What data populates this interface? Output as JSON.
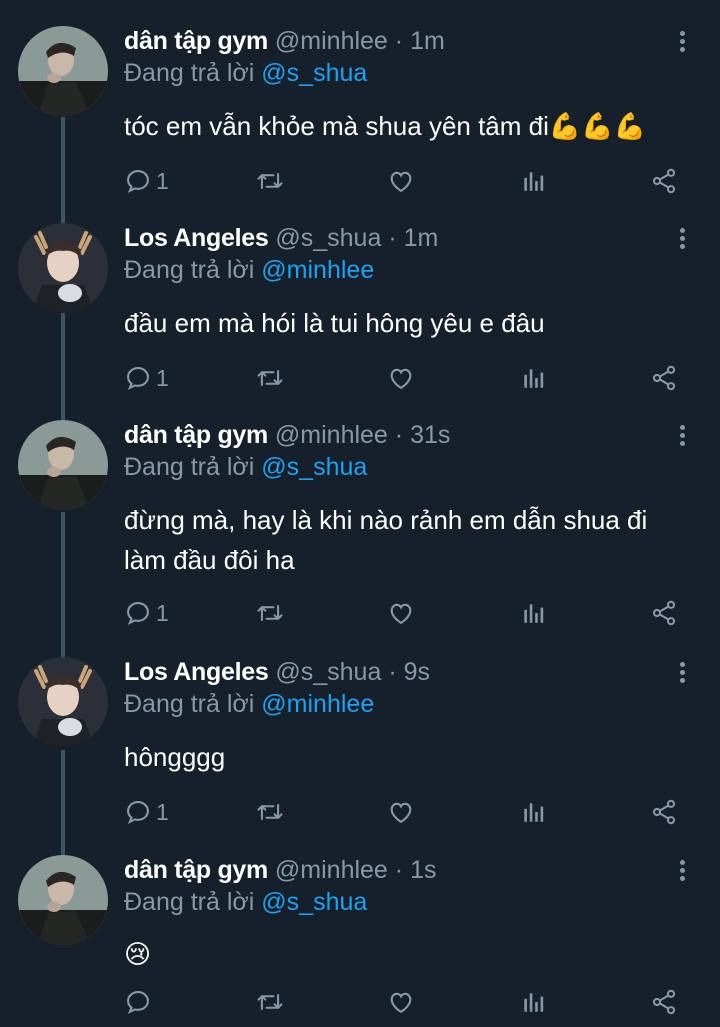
{
  "thread": {
    "tweets": [
      {
        "name": "dân tập gym",
        "handle": "@minhlee",
        "time": "1m",
        "reply_prefix": "Đang trả lời",
        "reply_to": "@s_shua",
        "text": "tóc em vẫn khỏe mà shua yên tâm đi💪💪💪",
        "replies": "1"
      },
      {
        "name": "Los Angeles",
        "handle": "@s_shua",
        "time": "1m",
        "reply_prefix": "Đang trả lời",
        "reply_to": "@minhlee",
        "text": "đầu em mà hói là tui hông yêu e đâu",
        "replies": "1"
      },
      {
        "name": "dân tập gym",
        "handle": "@minhlee",
        "time": "31s",
        "reply_prefix": "Đang trả lời",
        "reply_to": "@s_shua",
        "text": "đừng mà, hay là khi nào rảnh em dẫn shua đi làm đầu đôi ha",
        "replies": "1"
      },
      {
        "name": "Los Angeles",
        "handle": "@s_shua",
        "time": "9s",
        "reply_prefix": "Đang trả lời",
        "reply_to": "@minhlee",
        "text": "hôngggg",
        "replies": "1"
      },
      {
        "name": "dân tập gym",
        "handle": "@minhlee",
        "time": "1s",
        "reply_prefix": "Đang trả lời",
        "reply_to": "@s_shua",
        "text": "😢",
        "replies": ""
      }
    ]
  },
  "colors": {
    "background": "#15202b",
    "muted": "#8899a6",
    "link": "#1da1f2",
    "thread_line": "#3d5466"
  },
  "icons": [
    "reply-icon",
    "retweet-icon",
    "like-icon",
    "analytics-icon",
    "share-icon",
    "more-icon"
  ]
}
